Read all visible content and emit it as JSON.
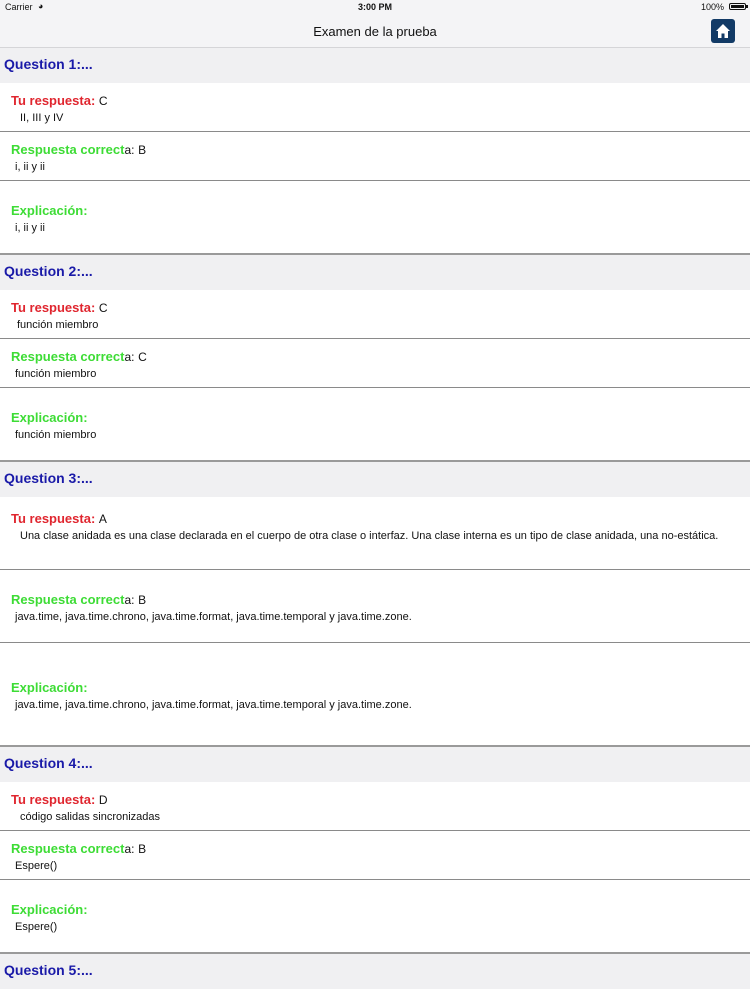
{
  "status": {
    "carrier": "Carrier",
    "time": "3:00 PM",
    "battery": "100%"
  },
  "nav": {
    "title": "Examen de la prueba",
    "home_icon": "home-icon"
  },
  "labels": {
    "your_answer": "Tu respuesta:",
    "correct_a": "Respuesta correct",
    "correct_b": "a:",
    "explanation": "Explicación:"
  },
  "questions": [
    {
      "title": "Question 1:...",
      "your_letter": "C",
      "your_text": "II, III y IV",
      "correct_letter": "B",
      "correct_text": "i, ii y ii",
      "explanation": "i, ii y ii"
    },
    {
      "title": "Question 2:...",
      "your_letter": "C",
      "your_text": "función miembro",
      "correct_letter": "C",
      "correct_text": "función miembro",
      "explanation": "función miembro"
    },
    {
      "title": "Question 3:...",
      "your_letter": "A",
      "your_text": "Una clase anidada es una clase declarada en el cuerpo de otra clase o interfaz. Una clase interna es un tipo de clase anidada, una no-estática.",
      "correct_letter": "B",
      "correct_text": "java.time, java.time.chrono, java.time.format, java.time.temporal y java.time.zone.",
      "explanation": "java.time, java.time.chrono, java.time.format, java.time.temporal y java.time.zone."
    },
    {
      "title": "Question 4:...",
      "your_letter": "D",
      "your_text": "código salidas sincronizadas",
      "correct_letter": "B",
      "correct_text": "Espere()",
      "explanation": "Espere()"
    },
    {
      "title": "Question 5:..."
    }
  ]
}
